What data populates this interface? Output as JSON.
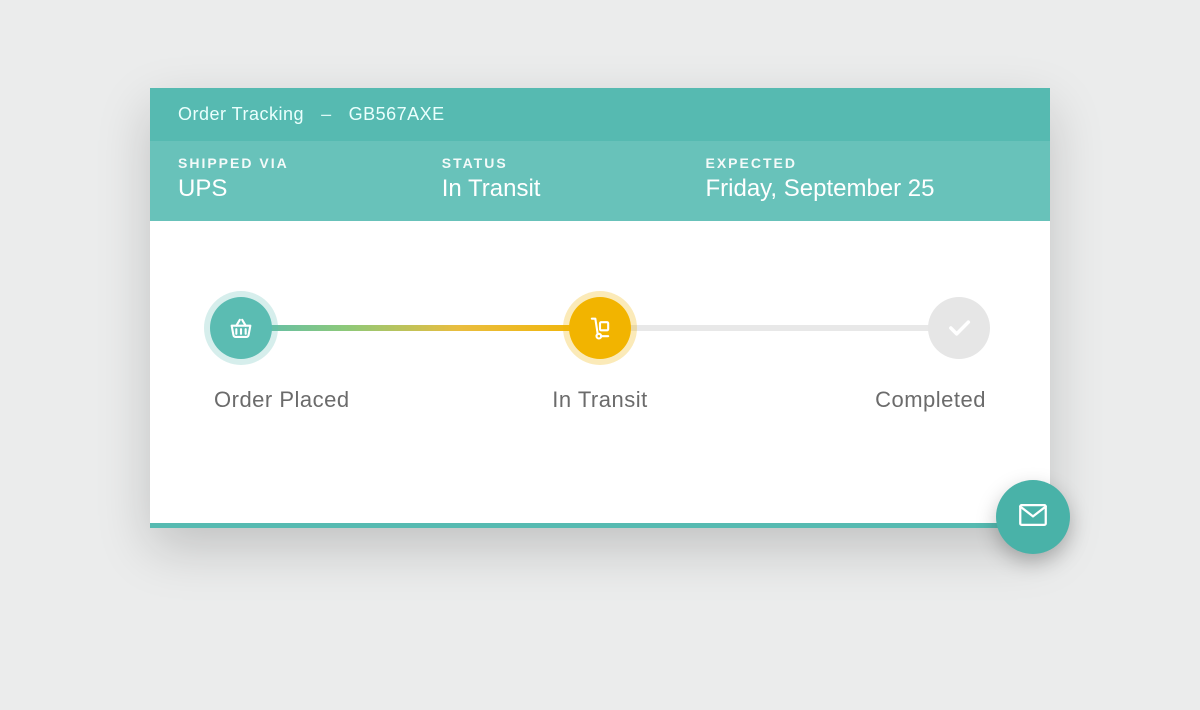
{
  "header": {
    "title": "Order Tracking",
    "order_number": "GB567AXE"
  },
  "info": {
    "shipped_via_label": "SHIPPED VIA",
    "shipped_via_value": "UPS",
    "status_label": "STATUS",
    "status_value": "In Transit",
    "expected_label": "EXPECTED",
    "expected_value": "Friday, September 25"
  },
  "steps": {
    "placed": "Order Placed",
    "transit": "In Transit",
    "completed": "Completed"
  },
  "colors": {
    "teal_dark": "#56bab1",
    "teal_light": "#68c2ba",
    "amber": "#f2b400",
    "grey": "#e6e6e6"
  }
}
